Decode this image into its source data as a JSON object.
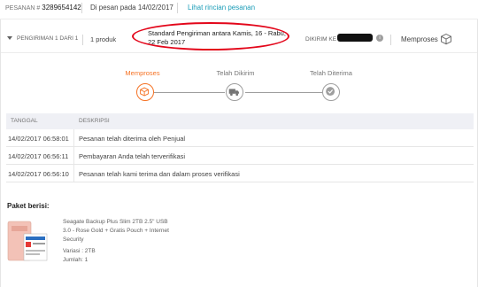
{
  "header": {
    "order_label": "PESANAN #",
    "order_number": "3289654142",
    "order_date": "Di pesan pada 14/02/2017",
    "detail_link": "Lihat rincian pesanan"
  },
  "shipment": {
    "label": "PENGIRIMAN 1 DARI 1",
    "product_count": "1 produk",
    "estimate": "Standard Pengiriman antara Kamis, 16 - Rabu, 22 Feb 2017",
    "send_to_label": "DIKIRIM KE",
    "status": "Memproses"
  },
  "steps": [
    {
      "label": "Memproses",
      "icon": "box-icon",
      "active": true
    },
    {
      "label": "Telah Dikirim",
      "icon": "truck-icon",
      "active": false
    },
    {
      "label": "Telah Diterima",
      "icon": "check-icon",
      "active": false
    }
  ],
  "history": {
    "columns": [
      "TANGGAL",
      "DESKRIPSI"
    ],
    "rows": [
      {
        "date": "14/02/2017 06:58:01",
        "desc": "Pesanan telah diterima oleh Penjual"
      },
      {
        "date": "14/02/2017 06:56:11",
        "desc": "Pembayaran Anda telah terverifikasi"
      },
      {
        "date": "14/02/2017 06:56:10",
        "desc": "Pesanan telah kami terima dan dalam proses verifikasi"
      }
    ]
  },
  "package": {
    "title": "Paket berisi:",
    "product_name": "Seagate Backup Plus Slim 2TB 2.5\" USB 3.0 - Rose Gold + Gratis Pouch + Internet Security",
    "variant": "Variasi : 2TB",
    "quantity": "Jumlah: 1"
  },
  "colors": {
    "accent": "#f57224",
    "link": "#1a9cb7",
    "annotation": "#e3061a",
    "table_header": "#eff0f5"
  }
}
